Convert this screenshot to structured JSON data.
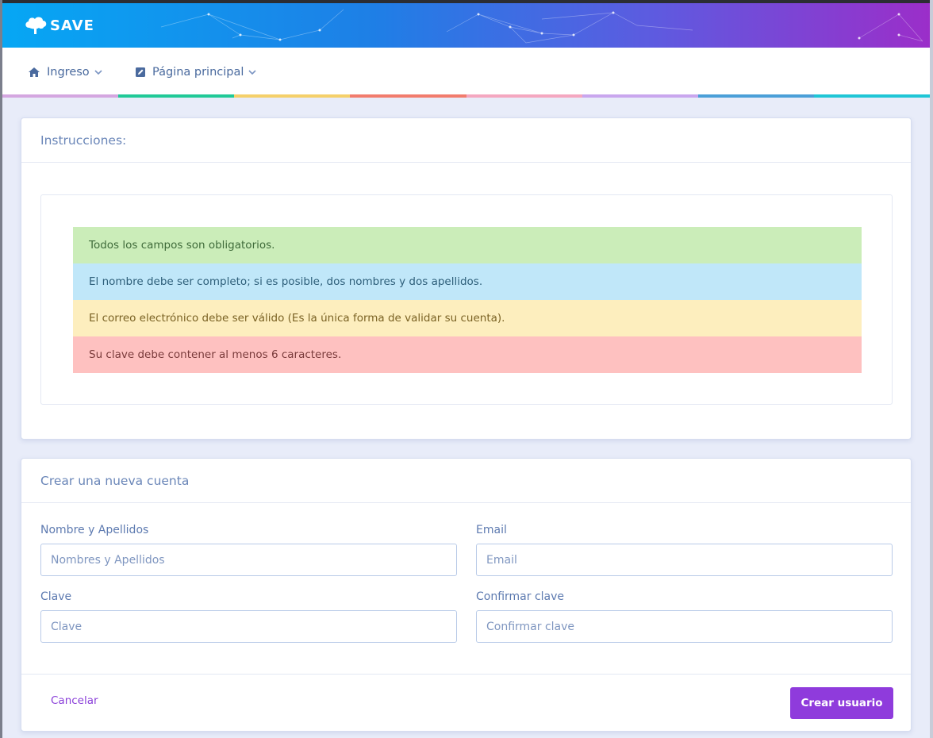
{
  "header": {
    "app_name": "SAVE",
    "colors": {
      "gradient_start": "#06a7f4",
      "gradient_end": "#9b2ec9"
    },
    "logo_icon": "tree-icon"
  },
  "nav": {
    "items": [
      {
        "label": "Ingreso",
        "icon": "home-icon"
      },
      {
        "label": "Página principal",
        "icon": "edit-icon"
      }
    ],
    "stripe_colors": [
      "#d4a6e0",
      "#20c997",
      "#f5d06a",
      "#f27c6d",
      "#f4a7c0",
      "#c9a6ee",
      "#4a9fd8",
      "#1fc6d6"
    ]
  },
  "instructions": {
    "title": "Instrucciones:",
    "items": [
      {
        "text": "Todos los campos son obligatorios.",
        "bg": "#cbedb9",
        "color": "#3f6b3a"
      },
      {
        "text": "El nombre debe ser completo; si es posible, dos nombres y dos apellidos.",
        "bg": "#c0e7f9",
        "color": "#2e5f7a"
      },
      {
        "text": "El correo electrónico debe ser válido (Es la única forma de validar su cuenta).",
        "bg": "#fdeebe",
        "color": "#7a6224"
      },
      {
        "text": "Su clave debe contener al menos 6 caracteres.",
        "bg": "#fec1c0",
        "color": "#7a3b3b"
      }
    ]
  },
  "form": {
    "title": "Crear una nueva cuenta",
    "fields": {
      "name": {
        "label": "Nombre y Apellidos",
        "placeholder": "Nombres y Apellidos",
        "value": ""
      },
      "email": {
        "label": "Email",
        "placeholder": "Email",
        "value": ""
      },
      "password": {
        "label": "Clave",
        "placeholder": "Clave",
        "value": ""
      },
      "confirm": {
        "label": "Confirmar clave",
        "placeholder": "Confirmar clave",
        "value": ""
      }
    },
    "cancel_label": "Cancelar",
    "submit_label": "Crear usuario",
    "accent": "#8f3bdc"
  }
}
